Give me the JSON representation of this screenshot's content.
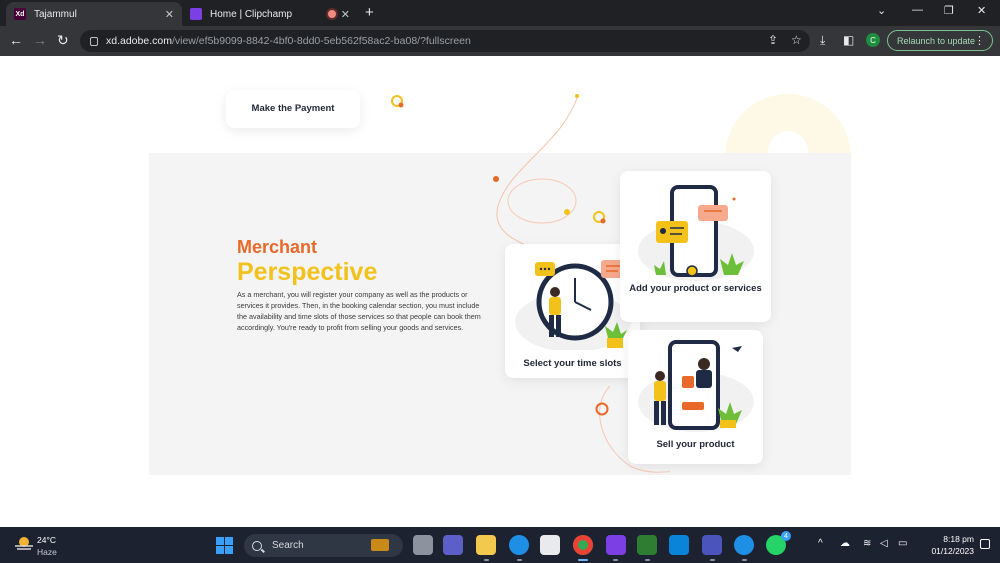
{
  "browser": {
    "tabs": [
      {
        "title": "Tajammul",
        "favicon_text": "Xd",
        "favicon_color": "#470137",
        "active": true
      },
      {
        "title": "Home | Clipchamp",
        "favicon_text": "",
        "favicon_color": "#7b3fe4",
        "active": false,
        "recording": true
      }
    ],
    "new_tab_glyph": "+",
    "url_host": "xd.adobe.com",
    "url_path": "/view/ef5b9099-8842-4bf0-8dd0-5eb562f58ac2-ba08/?fullscreen",
    "profile_initial": "C",
    "relaunch_label": "Relaunch to update"
  },
  "page": {
    "payment_card_label": "Make the Payment",
    "merchant_title": "Merchant",
    "perspective_title": "Perspective",
    "description": "As a merchant, you will register your company as well as the products or services it provides. Then, in the booking calendar section, you must include the availability and time slots of those services so that people can book them accordingly. You're ready to profit from selling your goods and services.",
    "cards": {
      "time_slots": "Select your time slots",
      "add_product": "Add your product or services",
      "sell_product": "Sell your product"
    },
    "colors": {
      "orange": "#e8692a",
      "yellow": "#f2c21b",
      "navy": "#1f2a44"
    }
  },
  "taskbar": {
    "weather_temp": "24°C",
    "weather_desc": "Haze",
    "search_label": "Search",
    "time": "8:18 pm",
    "date": "01/12/2023",
    "whatsapp_badge": "4"
  }
}
